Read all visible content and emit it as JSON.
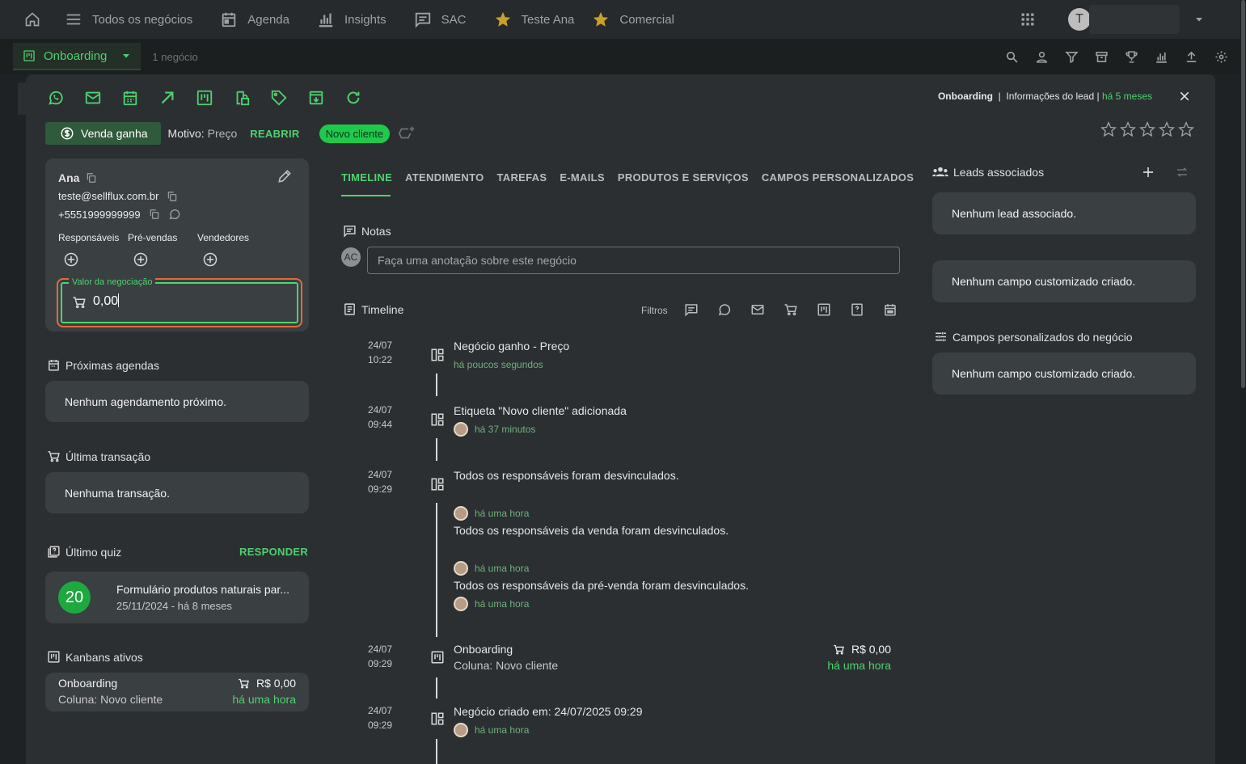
{
  "topnav": {
    "items": [
      "Todos os negócios",
      "Agenda",
      "Insights",
      "SAC",
      "Teste Ana",
      "Comercial"
    ],
    "avatar_letter": "T"
  },
  "subbar": {
    "pipeline": "Onboarding",
    "count": "1 negócio"
  },
  "header": {
    "crumb_pipeline": "Onboarding",
    "crumb_sep": "|",
    "crumb_info": "Informações do lead |",
    "crumb_time": "há 5 meses"
  },
  "status": {
    "venda": "Venda ganha",
    "motivo_label": "Motivo:",
    "motivo_value": "Preço",
    "reabrir": "REABRIR",
    "tag": "Novo cliente"
  },
  "lead": {
    "name": "Ana",
    "email": "teste@sellflux.com.br",
    "phone": "+5551999999999",
    "roles": [
      "Responsáveis",
      "Pré-vendas",
      "Vendedores"
    ],
    "valor_label": "Valor da negociação",
    "valor": "0,00"
  },
  "left": {
    "agendas_title": "Próximas agendas",
    "agendas_empty": "Nenhum agendamento próximo.",
    "transacao_title": "Última transação",
    "transacao_empty": "Nenhuma transação.",
    "quiz_title": "Último quiz",
    "quiz_action": "RESPONDER",
    "quiz_score": "20",
    "quiz_name": "Formulário produtos naturais par...",
    "quiz_date": "25/11/2024 - há 8 meses",
    "kanban_title": "Kanbans ativos",
    "kanban_name": "Onboarding",
    "kanban_col": "Coluna: Novo cliente",
    "kanban_value": "R$ 0,00",
    "kanban_time": "há uma hora"
  },
  "tabs": [
    "TIMELINE",
    "ATENDIMENTO",
    "TAREFAS",
    "E-MAILS",
    "PRODUTOS E SERVIÇOS",
    "CAMPOS PERSONALIZADOS"
  ],
  "notes": {
    "title": "Notas",
    "avatar": "AC",
    "placeholder": "Faça uma anotação sobre este negócio"
  },
  "timeline": {
    "title": "Timeline",
    "filters_label": "Filtros",
    "events": [
      {
        "date": "24/07",
        "time": "10:22",
        "title": "Negócio ganho - Preço",
        "sub": "há poucos segundos"
      },
      {
        "date": "24/07",
        "time": "09:44",
        "title": "Etiqueta \"Novo cliente\" adicionada",
        "sub": "há 37 minutos"
      },
      {
        "date": "24/07",
        "time": "09:29",
        "title": "Todos os responsáveis foram desvinculados.",
        "sub1": "há uma hora",
        "line2": "Todos os responsáveis da venda foram desvinculados.",
        "sub2": "há uma hora",
        "line3": "Todos os responsáveis da pré-venda foram desvinculados.",
        "sub3": "há uma hora"
      },
      {
        "date": "24/07",
        "time": "09:29",
        "title": "Onboarding",
        "col": "Coluna: Novo cliente",
        "value": "R$ 0,00",
        "sub": "há uma hora"
      },
      {
        "date": "24/07",
        "time": "09:29",
        "title": "Negócio criado em: 24/07/2025 09:29",
        "sub": "há uma hora"
      }
    ]
  },
  "right": {
    "leads_title": "Leads associados",
    "leads_empty": "Nenhum lead associado.",
    "custom_empty": "Nenhum campo customizado criado.",
    "campos_title": "Campos personalizados do negócio",
    "campos_empty": "Nenhum campo customizado criado."
  },
  "colors": {
    "accent": "#4fd16f",
    "focus": "#e56a3c",
    "tag": "#1fc94c",
    "bg": "#2b2f31",
    "card": "#3a3f42"
  }
}
